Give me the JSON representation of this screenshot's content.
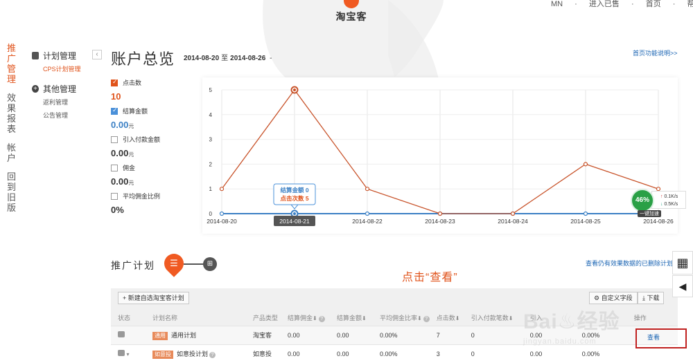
{
  "header": {
    "logo_text": "淘宝客",
    "links": [
      "MN",
      "·",
      "进入已售",
      "·",
      "首页",
      "·",
      "帮助"
    ]
  },
  "nav": {
    "items": [
      {
        "label": "推广管理",
        "active": true
      },
      {
        "label": "效果报表",
        "active": false
      },
      {
        "label": "帐户",
        "active": false
      },
      {
        "label": "回到旧版",
        "active": false
      }
    ],
    "groups": [
      {
        "label": "计划管理",
        "items": [
          {
            "label": "CPS计划管理",
            "active": true
          }
        ]
      },
      {
        "label": "其他管理",
        "items": [
          {
            "label": "返利管理",
            "active": false
          },
          {
            "label": "公告管理",
            "active": false
          }
        ]
      }
    ],
    "collapse_icon": "‹"
  },
  "overview": {
    "title": "账户总览",
    "date_start": "2014-08-20",
    "date_sep": "至",
    "date_end": "2014-08-26",
    "date_tail": "-",
    "help_link": "首页功能说明>>"
  },
  "metrics": [
    {
      "label": "点击数",
      "value": "10",
      "unit": "",
      "checked": true,
      "color": "red"
    },
    {
      "label": "结算金额",
      "value": "0.00",
      "unit": "元",
      "checked": true,
      "color": "blue"
    },
    {
      "label": "引入付款金额",
      "value": "0.00",
      "unit": "元",
      "checked": false,
      "color": "none"
    },
    {
      "label": "佣金",
      "value": "0.00",
      "unit": "元",
      "checked": false,
      "color": "none"
    },
    {
      "label": "平均佣金比例",
      "value": "0%",
      "unit": "",
      "checked": false,
      "color": "none"
    }
  ],
  "chart_data": {
    "type": "line",
    "categories": [
      "2014-08-20",
      "2014-08-21",
      "2014-08-22",
      "2014-08-23",
      "2014-08-24",
      "2014-08-25",
      "2014-08-26"
    ],
    "series": [
      {
        "name": "点击次数",
        "values": [
          1,
          5,
          1,
          0,
          0,
          2,
          1
        ],
        "color": "#c8532a"
      },
      {
        "name": "结算金额",
        "values": [
          0,
          0,
          0,
          0,
          0,
          0,
          0
        ],
        "color": "#3a7fc4"
      }
    ],
    "yticks": [
      0,
      1,
      2,
      3,
      4,
      5
    ],
    "ylim": [
      0,
      5
    ],
    "grid": true,
    "highlight_category": "2014-08-21",
    "tooltip": {
      "line1_label": "结算金额",
      "line1_value": "0",
      "line2_label": "点击次数",
      "line2_value": "5"
    }
  },
  "speed_widget": {
    "percent": "46%",
    "up": "0.1K/s",
    "down": "0.5K/s",
    "accel": "一键加速"
  },
  "plans": {
    "title": "推广计划",
    "list_icon": "☰",
    "grid_icon": "⊞",
    "hidden_link": "查看仍有效果数据的已删除计划>>",
    "annotation": "点击“查看”",
    "new_plan_button": "+ 新建自选淘宝客计划",
    "custom_cols_button": "⚙ 自定义字段",
    "download_button": "⤓ 下载",
    "columns": [
      "状态",
      "计划名称",
      "产品类型",
      "结算佣金",
      "结算金额",
      "平均佣金比率",
      "点击数",
      "引入付款笔数",
      "引入",
      "",
      "操作"
    ],
    "rows": [
      {
        "tag": "通用",
        "name": "通用计划",
        "type": "淘宝客",
        "commission": "0.00",
        "amount": "0.00",
        "rate": "0.00%",
        "clicks": "7",
        "orders": "0",
        "introduced": "0.00",
        "extra": "0.00%",
        "action": "查看"
      },
      {
        "tag": "如意投",
        "name": "如意投计划",
        "type": "如意投",
        "commission": "0.00",
        "amount": "0.00",
        "rate": "0.00%",
        "clicks": "3",
        "orders": "0",
        "introduced": "0.00",
        "extra": "0.00%",
        "action": ""
      }
    ]
  },
  "float": {
    "qr_icon": "▦",
    "speaker_icon": "◀"
  },
  "watermark": {
    "logo": "Bai♨经验",
    "url": "jingyan.baidu.com"
  }
}
